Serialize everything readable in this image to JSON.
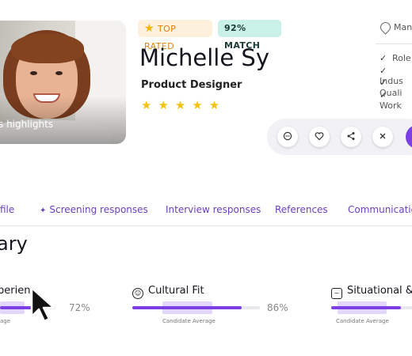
{
  "candidate": {
    "photo_caption": "s highlights",
    "badge_top_rated": "TOP RATED",
    "badge_match": "92% MATCH",
    "name": "Michelle Sy",
    "role": "Product Designer",
    "rating_stars": 5,
    "stars_text": "★★★★★",
    "location_truncated": "Manc",
    "checklist": [
      "Role",
      "Indus",
      "Quali",
      "Work"
    ]
  },
  "actions": {
    "message_icon": "chat-icon",
    "favorite_icon": "heart-icon",
    "share_icon": "share-icon",
    "reject_icon": "close-icon"
  },
  "tabs": [
    {
      "label": "file",
      "icon": ""
    },
    {
      "label": "Screening responses",
      "icon": "sparkle-icon"
    },
    {
      "label": "Interview responses",
      "icon": ""
    },
    {
      "label": "References",
      "icon": ""
    },
    {
      "label": "Communication",
      "icon": ""
    }
  ],
  "section_title": "ary",
  "scores": [
    {
      "title": "perien",
      "percent": "72%",
      "value": 0.72,
      "avg_label": "age"
    },
    {
      "title": "Cultural Fit",
      "percent": "86%",
      "value": 0.86,
      "avg_label": "Candidate Average"
    },
    {
      "title": "Situational &",
      "percent": "",
      "value": 0.8,
      "avg_label": "Candidate Average"
    }
  ],
  "colors": {
    "accent": "#7b3fe4",
    "star": "#f4c20d",
    "top_rated_text": "#e0820a",
    "match_bg": "#c9f1e8"
  }
}
